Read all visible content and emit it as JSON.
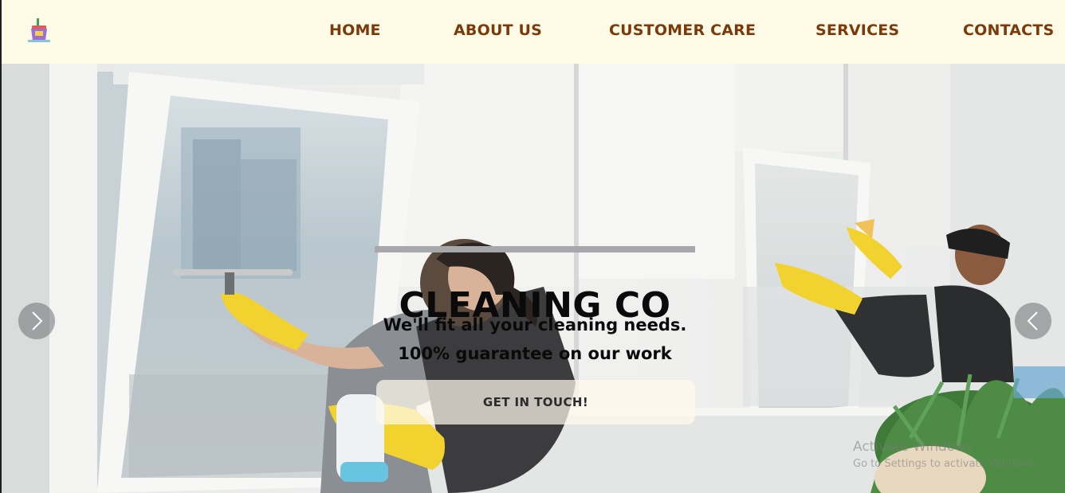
{
  "header": {
    "logo_icon": "cleaning-bucket-icon",
    "nav": [
      {
        "label": "HOME"
      },
      {
        "label": "ABOUT US"
      },
      {
        "label": "CUSTOMER CARE"
      },
      {
        "label": "SERVICES"
      },
      {
        "label": "CONTACTS"
      }
    ]
  },
  "hero": {
    "title": "CLEANING CO",
    "line1": "We'll fit all your cleaning needs.",
    "line2": "100% guarantee on our work",
    "cta_label": "GET IN TOUCH!",
    "prev_icon": "chevron-right-icon",
    "next_icon": "chevron-left-icon"
  },
  "watermark": {
    "title": "Activate Windows",
    "subtitle": "Go to Settings to activate Windows."
  },
  "colors": {
    "header_bg": "#fffbe6",
    "nav_text": "#7a3a0a",
    "glove_yellow": "#f2d22e"
  }
}
